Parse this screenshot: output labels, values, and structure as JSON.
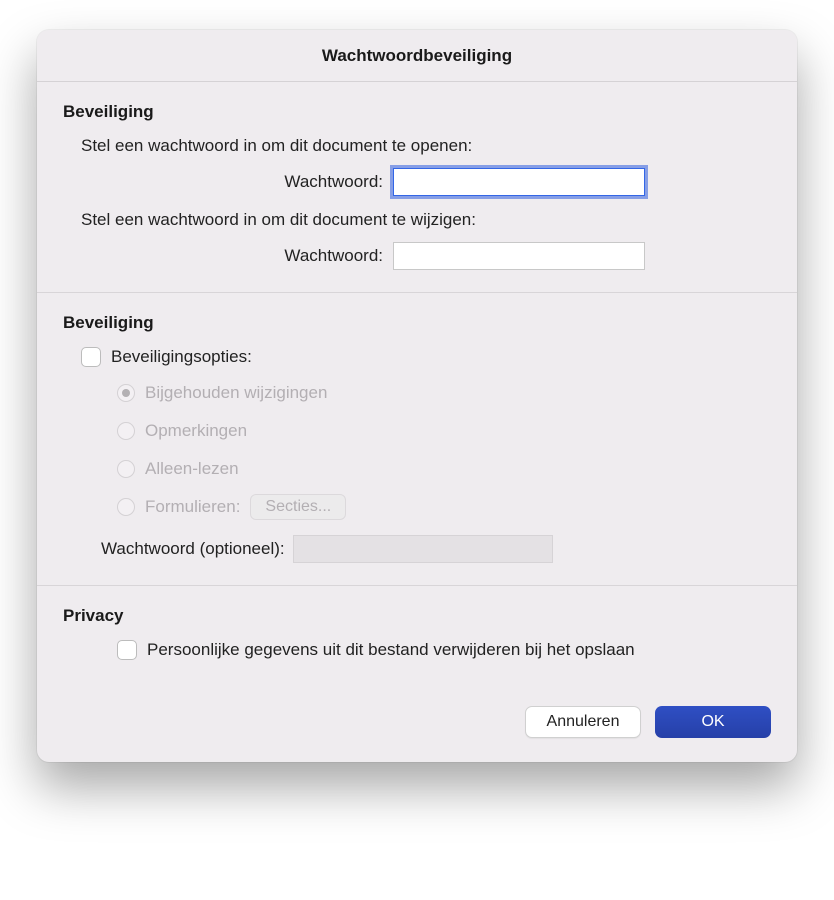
{
  "title": "Wachtwoordbeveiliging",
  "section1": {
    "heading": "Beveiliging",
    "open_prompt": "Stel een wachtwoord in om dit document te openen:",
    "open_label": "Wachtwoord:",
    "open_value": "",
    "modify_prompt": "Stel een wachtwoord in om dit document te wijzigen:",
    "modify_label": "Wachtwoord:",
    "modify_value": ""
  },
  "section2": {
    "heading": "Beveiliging",
    "options_label": "Beveiligingsopties:",
    "radios": {
      "tracked_changes": "Bijgehouden wijzigingen",
      "comments": "Opmerkingen",
      "readonly": "Alleen-lezen",
      "forms": "Formulieren:"
    },
    "sections_button": "Secties...",
    "optional_label": "Wachtwoord (optioneel):",
    "optional_value": ""
  },
  "section3": {
    "heading": "Privacy",
    "remove_personal_label": "Persoonlijke gegevens uit dit bestand verwijderen bij het opslaan"
  },
  "buttons": {
    "cancel": "Annuleren",
    "ok": "OK"
  }
}
